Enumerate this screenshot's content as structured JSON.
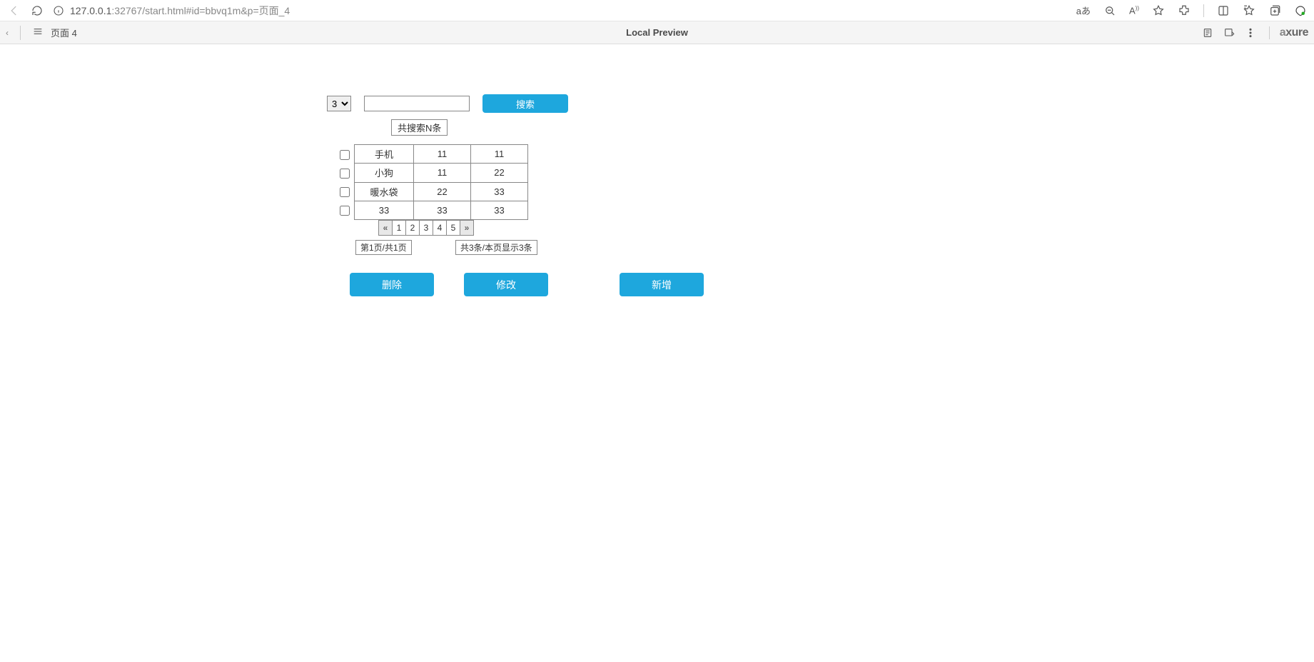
{
  "browser": {
    "url_host": "127.0.0.1",
    "url_port": ":32767",
    "url_path": "/start.html#id=bbvq1m&p=页面_4",
    "translate_label": "aあ"
  },
  "axure": {
    "page_name": "页面 4",
    "preview_label": "Local Preview",
    "logo": "axure"
  },
  "search": {
    "select_value": "3",
    "input_value": "",
    "button_label": "搜索",
    "count_label": "共搜索N条"
  },
  "table": {
    "rows": [
      {
        "c1": "手机",
        "c2": "11",
        "c3": "11"
      },
      {
        "c1": "小狗",
        "c2": "11",
        "c3": "22"
      },
      {
        "c1": "暖水袋",
        "c2": "22",
        "c3": "33"
      },
      {
        "c1": "33",
        "c2": "33",
        "c3": "33"
      }
    ]
  },
  "pagination": {
    "prev": "«",
    "pages": [
      "1",
      "2",
      "3",
      "4",
      "5"
    ],
    "next": "»",
    "page_info_left": "第1页/共1页",
    "page_info_right": "共3条/本页显示3条"
  },
  "actions": {
    "delete": "删除",
    "edit": "修改",
    "add": "新增"
  }
}
